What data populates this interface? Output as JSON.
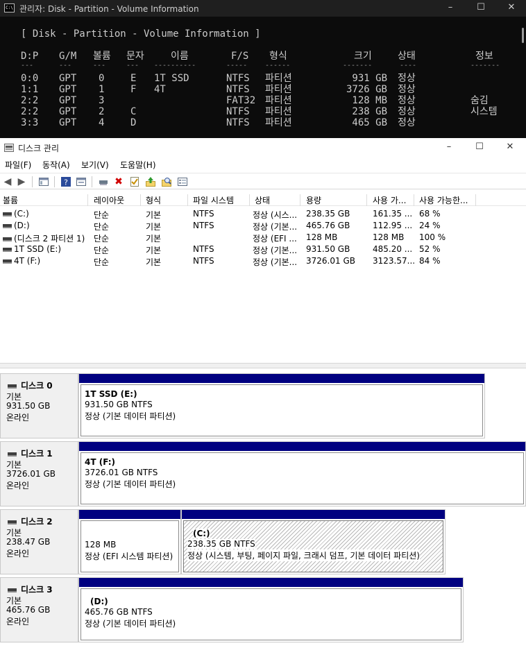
{
  "console": {
    "title": "관리자:  Disk - Partition - Volume Information",
    "heading": "[ Disk - Partition - Volume Information ]",
    "columns": [
      "D:P",
      "G/M",
      "볼륨",
      "문자",
      "이름",
      "F/S",
      "형식",
      "크기",
      "상태",
      "정보"
    ],
    "underlines": [
      "---",
      "---",
      "---",
      "---",
      "----------",
      "-----",
      "------",
      "-------",
      "----",
      "-------"
    ],
    "rows": [
      {
        "dp": "0:0",
        "gm": "GPT",
        "vol": "0",
        "letter": "E",
        "name": "1T SSD",
        "fs": "NTFS",
        "type": "파티션",
        "size": "931 GB",
        "status": "정상",
        "info": ""
      },
      {
        "dp": "1:1",
        "gm": "GPT",
        "vol": "1",
        "letter": "F",
        "name": "4T",
        "fs": "NTFS",
        "type": "파티션",
        "size": "3726 GB",
        "status": "정상",
        "info": ""
      },
      {
        "dp": "2:2",
        "gm": "GPT",
        "vol": "3",
        "letter": "",
        "name": "",
        "fs": "FAT32",
        "type": "파티션",
        "size": "128 MB",
        "status": "정상",
        "info": "숨김"
      },
      {
        "dp": "2:2",
        "gm": "GPT",
        "vol": "2",
        "letter": "C",
        "name": "",
        "fs": "NTFS",
        "type": "파티션",
        "size": "238 GB",
        "status": "정상",
        "info": "시스템"
      },
      {
        "dp": "3:3",
        "gm": "GPT",
        "vol": "4",
        "letter": "D",
        "name": "",
        "fs": "NTFS",
        "type": "파티션",
        "size": "465 GB",
        "status": "정상",
        "info": ""
      }
    ]
  },
  "dm": {
    "title": "디스크 관리",
    "menu": [
      "파일(F)",
      "동작(A)",
      "보기(V)",
      "도움말(H)"
    ],
    "toolbar_icons": [
      "back-arrow-icon",
      "forward-arrow-icon",
      "console-tree-icon",
      "help-icon",
      "properties-icon",
      "map-drive-icon",
      "delete-icon",
      "check-icon",
      "export-icon",
      "search-icon",
      "list-icon"
    ],
    "columns": [
      "볼륨",
      "레이아웃",
      "형식",
      "파일 시스템",
      "상태",
      "용량",
      "사용 가...",
      "사용 가능한..."
    ],
    "volumes": [
      {
        "name": "(C:)",
        "layout": "단순",
        "type": "기본",
        "fs": "NTFS",
        "status": "정상 (시스...",
        "capacity": "238.35 GB",
        "free": "161.35 ...",
        "pct": "68 %"
      },
      {
        "name": "(D:)",
        "layout": "단순",
        "type": "기본",
        "fs": "NTFS",
        "status": "정상 (기본...",
        "capacity": "465.76 GB",
        "free": "112.95 ...",
        "pct": "24 %"
      },
      {
        "name": "(디스크 2 파티션 1)",
        "layout": "단순",
        "type": "기본",
        "fs": "",
        "status": "정상 (EFI ...",
        "capacity": "128 MB",
        "free": "128 MB",
        "pct": "100 %"
      },
      {
        "name": "1T SSD (E:)",
        "layout": "단순",
        "type": "기본",
        "fs": "NTFS",
        "status": "정상 (기본...",
        "capacity": "931.50 GB",
        "free": "485.20 ...",
        "pct": "52 %"
      },
      {
        "name": "4T (F:)",
        "layout": "단순",
        "type": "기본",
        "fs": "NTFS",
        "status": "정상 (기본...",
        "capacity": "3726.01 GB",
        "free": "3123.57...",
        "pct": "84 %"
      }
    ],
    "disks": [
      {
        "name": "디스크 0",
        "kind": "기본",
        "size": "931.50 GB",
        "state": "온라인",
        "partitions": [
          {
            "label": "1T SSD  (E:)",
            "size": "931.50 GB NTFS",
            "status": "정상 (기본 데이터 파티션)"
          }
        ]
      },
      {
        "name": "디스크 1",
        "kind": "기본",
        "size": "3726.01 GB",
        "state": "온라인",
        "partitions": [
          {
            "label": "4T  (F:)",
            "size": "3726.01 GB NTFS",
            "status": "정상 (기본 데이터 파티션)"
          }
        ]
      },
      {
        "name": "디스크 2",
        "kind": "기본",
        "size": "238.47 GB",
        "state": "온라인",
        "partitions": [
          {
            "label": "",
            "size": "128 MB",
            "status": "정상 (EFI 시스템 파티션)"
          },
          {
            "label": "(C:)",
            "size": "238.35 GB NTFS",
            "status": "정상 (시스템, 부팅, 페이지 파일, 크래시 덤프, 기본 데이터 파티션)"
          }
        ]
      },
      {
        "name": "디스크 3",
        "kind": "기본",
        "size": "465.76 GB",
        "state": "온라인",
        "partitions": [
          {
            "label": "(D:)",
            "size": "465.76 GB NTFS",
            "status": "정상 (기본 데이터 파티션)"
          }
        ]
      }
    ]
  }
}
